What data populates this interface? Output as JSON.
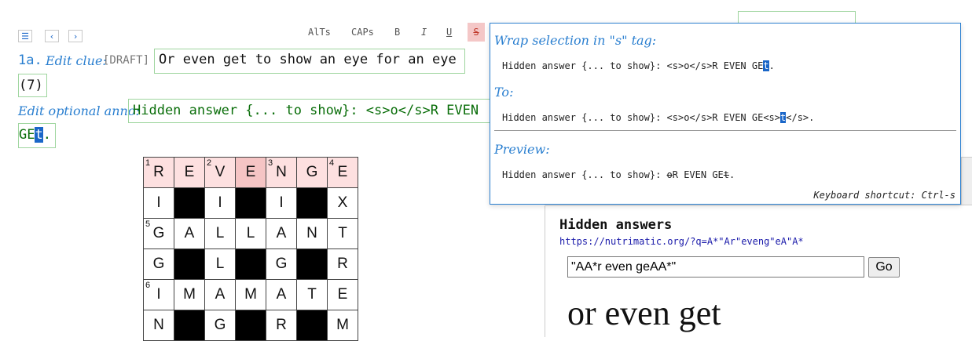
{
  "nav": {
    "menu_icon": "menu-icon",
    "prev_icon": "chevron-left-icon",
    "next_icon": "chevron-right-icon"
  },
  "format": {
    "alts": "AlTs",
    "caps": "CAPs",
    "bold": "B",
    "italic": "I",
    "underline": "U",
    "strike": "S"
  },
  "clue": {
    "number": "1a.",
    "edit_label": "Edit clue:",
    "draft": "[DRAFT]",
    "text": "Or even get to show an eye for an eye",
    "enum": "(7)"
  },
  "anno": {
    "label": "Edit optional anno:",
    "line1": "Hidden answer {... to show}: <s>o</s>R EVEN",
    "line2_pre": "GE",
    "line2_sel": "t",
    "line2_post": "."
  },
  "grid": {
    "rows": [
      [
        "R",
        "E",
        "V",
        "E",
        "N",
        "G",
        "E"
      ],
      [
        "I",
        "#",
        "I",
        "#",
        "I",
        "#",
        "X"
      ],
      [
        "G",
        "A",
        "L",
        "L",
        "A",
        "N",
        "T"
      ],
      [
        "G",
        "#",
        "L",
        "#",
        "G",
        "#",
        "R"
      ],
      [
        "I",
        "M",
        "A",
        "M",
        "A",
        "T",
        "E"
      ],
      [
        "N",
        "#",
        "G",
        "#",
        "R",
        "#",
        "M"
      ]
    ],
    "numbers": [
      {
        "r": 0,
        "c": 0,
        "n": "1"
      },
      {
        "r": 0,
        "c": 2,
        "n": "2"
      },
      {
        "r": 0,
        "c": 4,
        "n": "3"
      },
      {
        "r": 0,
        "c": 6,
        "n": "4"
      },
      {
        "r": 2,
        "c": 0,
        "n": "5"
      },
      {
        "r": 4,
        "c": 0,
        "n": "6"
      }
    ]
  },
  "popup": {
    "wrap_heading": "Wrap selection in \"s\" tag:",
    "from_pre": "Hidden answer {... to show}: <s>o</s>R EVEN GE",
    "from_sel": "t",
    "from_post": ".",
    "to_heading": "To:",
    "to_pre": "Hidden answer {... to show}: <s>o</s>R EVEN GE<s>",
    "to_sel": "t",
    "to_post": "</s>.",
    "preview_heading": "Preview:",
    "preview_pre": "Hidden answer {... to show}: ",
    "preview_strike1": "o",
    "preview_mid": "R EVEN GE",
    "preview_strike2": "t",
    "preview_post": ".",
    "shortcut": "Keyboard shortcut: Ctrl-s"
  },
  "panel": {
    "title": "Hidden answers",
    "link": "https://nutrimatic.org/?q=A*\"Ar\"eveng\"eA\"A*",
    "query": "\"AA*r even geAA*\"",
    "go": "Go",
    "result": "or even get"
  },
  "colors": {
    "accent": "#2a7fd0",
    "anno_green": "#0a6e0a",
    "box_border": "#9ed59e",
    "highlight": "#fde0e0"
  }
}
